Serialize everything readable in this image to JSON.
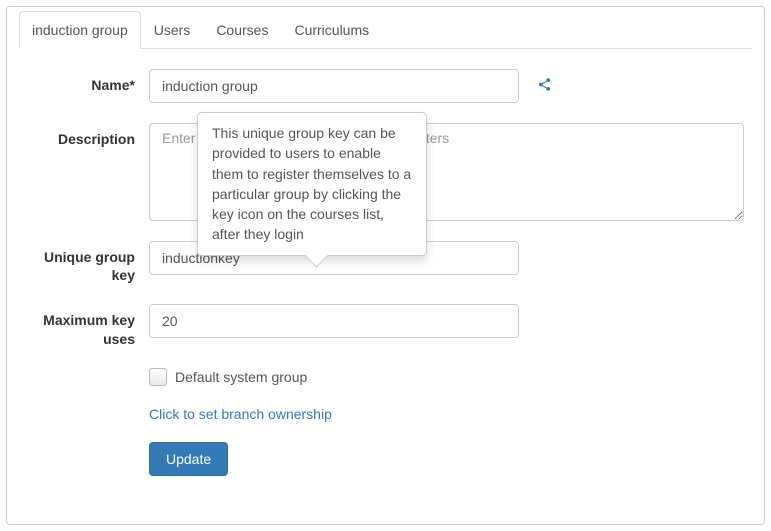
{
  "tabs": {
    "group": "induction group",
    "users": "Users",
    "courses": "Courses",
    "curriculums": "Curriculums"
  },
  "labels": {
    "name": "Name*",
    "description": "Description",
    "unique_key": "Unique group key",
    "max_uses": "Maximum key uses"
  },
  "fields": {
    "name_value": "induction group",
    "description_placeholder": "Enter a short description, up to 500 characters",
    "unique_key_value": "inductionkey",
    "max_uses_value": "20"
  },
  "checkbox": {
    "default_group": "Default system group"
  },
  "links": {
    "branch_ownership": "Click to set branch ownership"
  },
  "buttons": {
    "update": "Update"
  },
  "tooltip": "This unique group key can be provided to users to enable them to register themselves to a particular group by clicking the key icon on the courses list, after they login"
}
